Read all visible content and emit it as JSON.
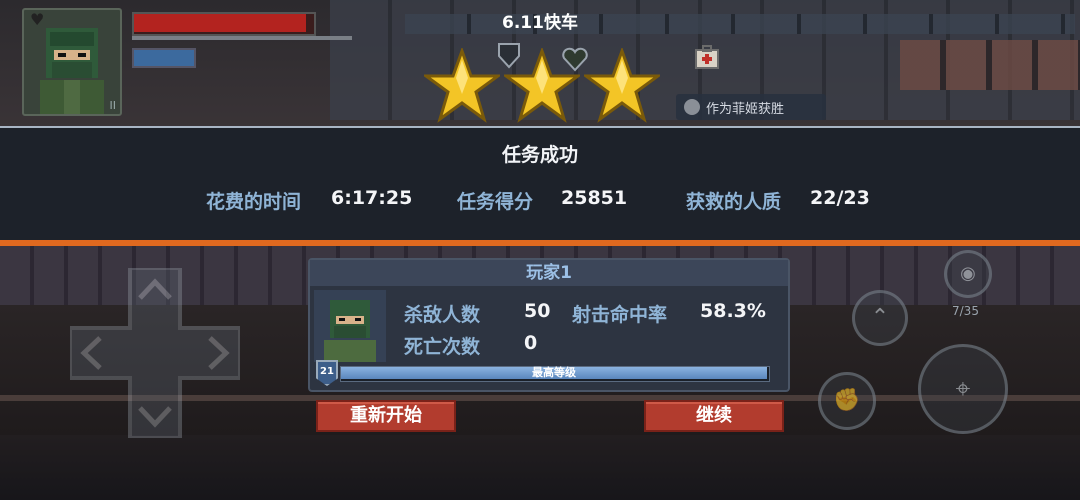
{
  "hud": {
    "portrait_tag": "II"
  },
  "top": {
    "level_title": "6.11快车",
    "stars_earned": 3,
    "stars_total": 3,
    "bonus_text": "作为菲姬获胜"
  },
  "banner": {
    "title": "任务成功",
    "stats": [
      {
        "label": "花费的时间",
        "value": "6:17:25"
      },
      {
        "label": "任务得分",
        "value": "25851"
      },
      {
        "label": "获救的人质",
        "value": "22/23"
      }
    ]
  },
  "player": {
    "name": "玩家1",
    "kills_label": "杀敌人数",
    "kills": "50",
    "accuracy_label": "射击命中率",
    "accuracy": "58.3%",
    "deaths_label": "死亡次数",
    "deaths": "0",
    "level": "21",
    "xp_label": "最高等级",
    "xp_fraction": 1.0
  },
  "buttons": {
    "restart": "重新开始",
    "continue": "继续"
  },
  "controls": {
    "ammo": "7/35"
  },
  "colors": {
    "accent_orange": "#e0691f",
    "button_red": "#b23c2e",
    "label_blue": "#8fb4d6",
    "star_gold": "#f3c526"
  }
}
